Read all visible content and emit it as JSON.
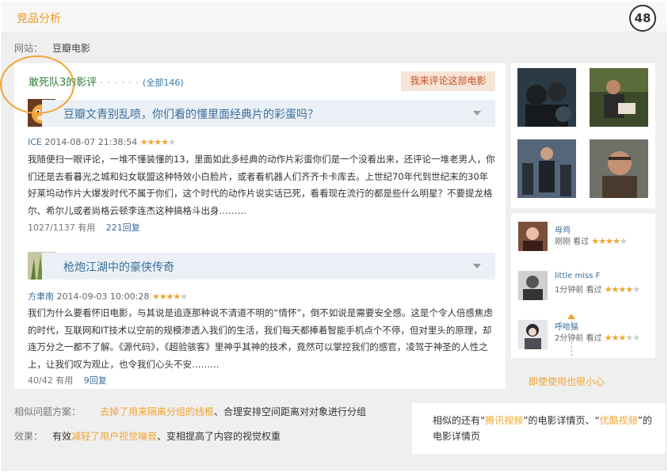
{
  "header": {
    "section_title": "竞品分析",
    "page_number": "48"
  },
  "site": {
    "label": "网站：",
    "value": "豆瓣电影"
  },
  "panel": {
    "title": "敢死队3的影评",
    "dots": "· · · · · ·",
    "count": "(全部146)",
    "write_review": "我来评论这部电影"
  },
  "reviews": [
    {
      "title": "豆瓣文青别乱喷，你们看的懂里面经典片的彩蛋吗？",
      "author": "ICE",
      "date": "2014-08-07 21:38:54",
      "rating": 4,
      "body": "我随便扫一眼评论，一堆不懂装懂的13，里面如此多经典的动作片彩蛋你们是一个没看出来，还评论一堆老男人，你们还是去看暮光之城和妇女联盟这种特效小白脸片，或者看机器人们齐齐卡卡库去。上世纪70年代到世纪末的30年好莱坞动作片大爆发时代不属于你们，这个时代的动作片说实话已死，看看现在流行的都是些什么明星？不要提龙格尔、希尔儿或者尚格云顿李连杰这种搞格斗出身………",
      "votes": "1027/1137 有用",
      "replies": "221回复"
    },
    {
      "title": "枪炮江湖中的豪侠传奇",
      "author": "方聿南",
      "date": "2014-09-03 10:00:28",
      "rating": 4,
      "body": "我们为什么要看怀旧电影，与其说是追逐那种说不清道不明的“情怀”，倒不如说是需要安全感。这是个令人倍感焦虑的时代，互联网和IT技术以空前的规模渗透入我们的生活，我们每天都捧着智能手机点个不停，但对里头的原理，却连万分之一都不了解。《源代码》，《超验骇客》里神乎其神的技术，竟然可以掌控我们的感官，凌驾于神圣的人性之上，让我们叹为观止，也令我们心头不安………",
      "votes": "40/42 有用",
      "replies": "9回复"
    }
  ],
  "watchers": [
    {
      "name": "母鸡",
      "time": "刚刚 看过",
      "rating": 4
    },
    {
      "name": "little miss F",
      "time": "1分钟前 看过",
      "rating": 4
    },
    {
      "name": "呼哈猫",
      "time": "2分钟前 看过",
      "rating": 3
    }
  ],
  "annotation": "即使使用也很小心",
  "solution": {
    "label": "相似问题方案：",
    "highlight": "去掉了用来隔离分组的线框",
    "rest": "、合理安排空间距离对对象进行分组"
  },
  "effect": {
    "label": "效果：",
    "prefix": "有效",
    "highlight": "减轻了用户视觉噪音",
    "rest": "、变相提高了内容的视觉权重"
  },
  "similar": {
    "prefix": "相似的还有“",
    "site1": "腾讯视频",
    "middle": "”的电影详情页、“",
    "site2": "优酷视频",
    "suffix": "”的电影详情页"
  },
  "colors": {
    "accent": "#f0a431",
    "title_green": "#2d7d35",
    "link_blue": "#3b6d9c"
  }
}
